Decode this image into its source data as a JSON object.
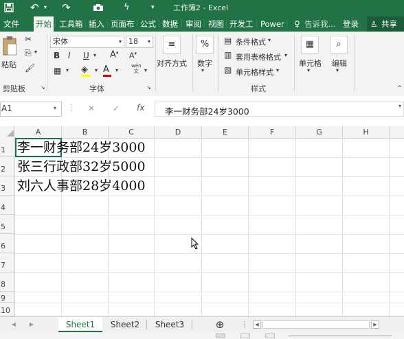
{
  "window": {
    "title": "工作簿2 - Excel"
  },
  "ribbon_tabs": [
    "文件",
    "开始",
    "工具箱",
    "插入",
    "页面布",
    "公式",
    "数据",
    "审阅",
    "视图",
    "开发工",
    "Power"
  ],
  "active_tab": "开始",
  "tellme": "告诉我...",
  "login": "登录",
  "share": "共享",
  "clipboard": {
    "paste": "粘贴",
    "group": "剪贴板"
  },
  "font": {
    "name": "宋体",
    "size": "18",
    "bold": "B",
    "italic": "I",
    "underline": "U",
    "group": "字体",
    "wen": "wén",
    "wen2": "文"
  },
  "alignment": {
    "label": "对齐方式"
  },
  "number": {
    "label": "数字",
    "symbol": "%"
  },
  "styles": {
    "conditional": "条件格式",
    "table": "套用表格格式",
    "cell": "单元格样式",
    "group": "样式"
  },
  "cells": {
    "label": "单元格"
  },
  "editing": {
    "label": "编辑"
  },
  "formula_bar": {
    "name_box": "A1",
    "cancel": "✕",
    "enter": "✓",
    "fx": "fx",
    "content": "李一财务部24岁3000"
  },
  "columns": [
    "A",
    "B",
    "C",
    "D",
    "E",
    "F",
    "G",
    "H"
  ],
  "rows": [
    "1",
    "2",
    "3",
    "4",
    "5",
    "6",
    "7",
    "8",
    "9",
    "10"
  ],
  "cells_data": [
    "李一财务部24岁3000",
    "张三行政部32岁5000",
    "刘六人事部28岁4000"
  ],
  "sheets": [
    "Sheet1",
    "Sheet2",
    "Sheet3"
  ],
  "active_sheet": "Sheet1",
  "colors": {
    "accent": "#217346",
    "ribbon_bg": "#f3f3f3"
  }
}
